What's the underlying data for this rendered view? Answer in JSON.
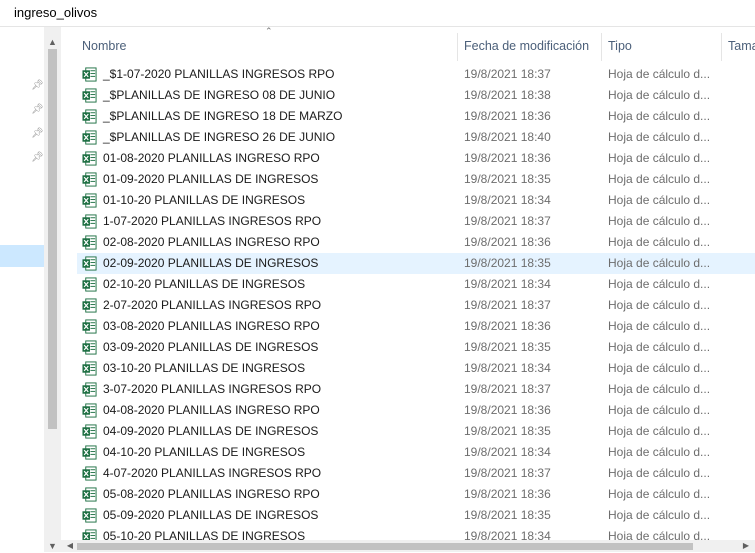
{
  "window": {
    "title": "ingreso_olivos"
  },
  "columns": {
    "name": "Nombre",
    "date": "Fecha de modificación",
    "type": "Tipo",
    "size": "Tama"
  },
  "files": [
    {
      "name": "_$1-07-2020 PLANILLAS INGRESOS RPO",
      "date": "19/8/2021 18:37",
      "type": "Hoja de cálculo d..."
    },
    {
      "name": "_$PLANILLAS DE INGRESO 08 DE JUNIO",
      "date": "19/8/2021 18:38",
      "type": "Hoja de cálculo d..."
    },
    {
      "name": "_$PLANILLAS DE INGRESO 18 DE MARZO",
      "date": "19/8/2021 18:36",
      "type": "Hoja de cálculo d..."
    },
    {
      "name": "_$PLANILLAS DE INGRESO 26 DE JUNIO",
      "date": "19/8/2021 18:40",
      "type": "Hoja de cálculo d..."
    },
    {
      "name": "01-08-2020 PLANILLAS INGRESO RPO",
      "date": "19/8/2021 18:36",
      "type": "Hoja de cálculo d..."
    },
    {
      "name": "01-09-2020 PLANILLAS DE INGRESOS",
      "date": "19/8/2021 18:35",
      "type": "Hoja de cálculo d..."
    },
    {
      "name": "01-10-20 PLANILLAS DE INGRESOS",
      "date": "19/8/2021 18:34",
      "type": "Hoja de cálculo d..."
    },
    {
      "name": "1-07-2020 PLANILLAS INGRESOS RPO",
      "date": "19/8/2021 18:37",
      "type": "Hoja de cálculo d..."
    },
    {
      "name": "02-08-2020 PLANILLAS INGRESO RPO",
      "date": "19/8/2021 18:36",
      "type": "Hoja de cálculo d..."
    },
    {
      "name": "02-09-2020 PLANILLAS DE INGRESOS",
      "date": "19/8/2021 18:35",
      "type": "Hoja de cálculo d..."
    },
    {
      "name": "02-10-20 PLANILLAS DE INGRESOS",
      "date": "19/8/2021 18:34",
      "type": "Hoja de cálculo d..."
    },
    {
      "name": "2-07-2020 PLANILLAS INGRESOS RPO",
      "date": "19/8/2021 18:37",
      "type": "Hoja de cálculo d..."
    },
    {
      "name": "03-08-2020 PLANILLAS INGRESO RPO",
      "date": "19/8/2021 18:36",
      "type": "Hoja de cálculo d..."
    },
    {
      "name": "03-09-2020 PLANILLAS DE INGRESOS",
      "date": "19/8/2021 18:35",
      "type": "Hoja de cálculo d..."
    },
    {
      "name": "03-10-20 PLANILLAS DE INGRESOS",
      "date": "19/8/2021 18:34",
      "type": "Hoja de cálculo d..."
    },
    {
      "name": "3-07-2020 PLANILLAS INGRESOS RPO",
      "date": "19/8/2021 18:37",
      "type": "Hoja de cálculo d..."
    },
    {
      "name": "04-08-2020  PLANILLAS INGRESO RPO",
      "date": "19/8/2021 18:36",
      "type": "Hoja de cálculo d..."
    },
    {
      "name": "04-09-2020 PLANILLAS DE INGRESOS",
      "date": "19/8/2021 18:35",
      "type": "Hoja de cálculo d..."
    },
    {
      "name": "04-10-20 PLANILLAS DE INGRESOS",
      "date": "19/8/2021 18:34",
      "type": "Hoja de cálculo d..."
    },
    {
      "name": "4-07-2020 PLANILLAS INGRESOS RPO",
      "date": "19/8/2021 18:37",
      "type": "Hoja de cálculo d..."
    },
    {
      "name": "05-08-2020  PLANILLAS INGRESO RPO",
      "date": "19/8/2021 18:36",
      "type": "Hoja de cálculo d..."
    },
    {
      "name": "05-09-2020 PLANILLAS DE INGRESOS",
      "date": "19/8/2021 18:35",
      "type": "Hoja de cálculo d..."
    },
    {
      "name": "05-10-20 PLANILLAS DE INGRESOS",
      "date": "19/8/2021 18:34",
      "type": "Hoja de cálculo d..."
    }
  ],
  "selected_index": 9,
  "icons": {
    "file": "excel-file-icon",
    "pin": "pin-icon",
    "sort": "sort-ascending-icon"
  },
  "colors": {
    "selected_row": "#e5f3ff",
    "nav_selected": "#cce8ff",
    "header_text": "#4c607a",
    "excel_green": "#1d6f42"
  }
}
